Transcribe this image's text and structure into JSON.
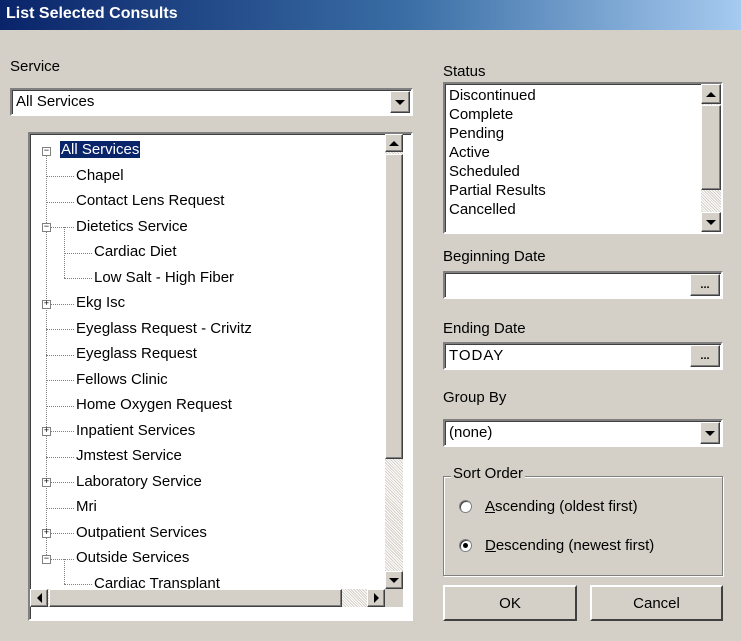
{
  "window": {
    "title": "List Selected Consults"
  },
  "service": {
    "label": "Service",
    "combo_value": "All Services",
    "tree": [
      {
        "label": "All Services",
        "level": 0,
        "expander": "-",
        "selected": true
      },
      {
        "label": "Chapel",
        "level": 1
      },
      {
        "label": "Contact Lens Request",
        "level": 1
      },
      {
        "label": "Dietetics Service",
        "level": 1,
        "expander": "-"
      },
      {
        "label": "Cardiac Diet",
        "level": 2
      },
      {
        "label": "Low Salt - High Fiber",
        "level": 2
      },
      {
        "label": "Ekg Isc",
        "level": 1,
        "expander": "+"
      },
      {
        "label": "Eyeglass Request - Crivitz",
        "level": 1
      },
      {
        "label": "Eyeglass Request",
        "level": 1
      },
      {
        "label": "Fellows Clinic",
        "level": 1
      },
      {
        "label": "Home Oxygen Request",
        "level": 1
      },
      {
        "label": "Inpatient Services",
        "level": 1,
        "expander": "+"
      },
      {
        "label": "Jmstest Service",
        "level": 1
      },
      {
        "label": "Laboratory Service",
        "level": 1,
        "expander": "+"
      },
      {
        "label": "Mri",
        "level": 1
      },
      {
        "label": "Outpatient Services",
        "level": 1,
        "expander": "+"
      },
      {
        "label": "Outside Services",
        "level": 1,
        "expander": "-"
      },
      {
        "label": "Cardiac Transplant",
        "level": 2
      }
    ]
  },
  "status": {
    "label": "Status",
    "items": [
      "Discontinued",
      "Complete",
      "Pending",
      "Active",
      "Scheduled",
      "Partial Results",
      "Cancelled"
    ]
  },
  "beginning_date": {
    "label": "Beginning Date",
    "value": "",
    "button": "..."
  },
  "ending_date": {
    "label": "Ending Date",
    "value": "TODAY",
    "button": "..."
  },
  "group_by": {
    "label": "Group By",
    "value": "(none)"
  },
  "sort_order": {
    "label": "Sort Order",
    "options": [
      {
        "label": "Ascending (oldest first)",
        "accel": "A",
        "rest": "scending (oldest first)",
        "checked": false
      },
      {
        "label": "Descending (newest first)",
        "accel": "D",
        "rest": "escending (newest first)",
        "checked": true
      }
    ]
  },
  "buttons": {
    "ok": "OK",
    "cancel": "Cancel"
  },
  "colors": {
    "title_start": "#0a246a",
    "title_end": "#a6caf0",
    "face": "#d4d0c8",
    "selection": "#0a246a"
  }
}
